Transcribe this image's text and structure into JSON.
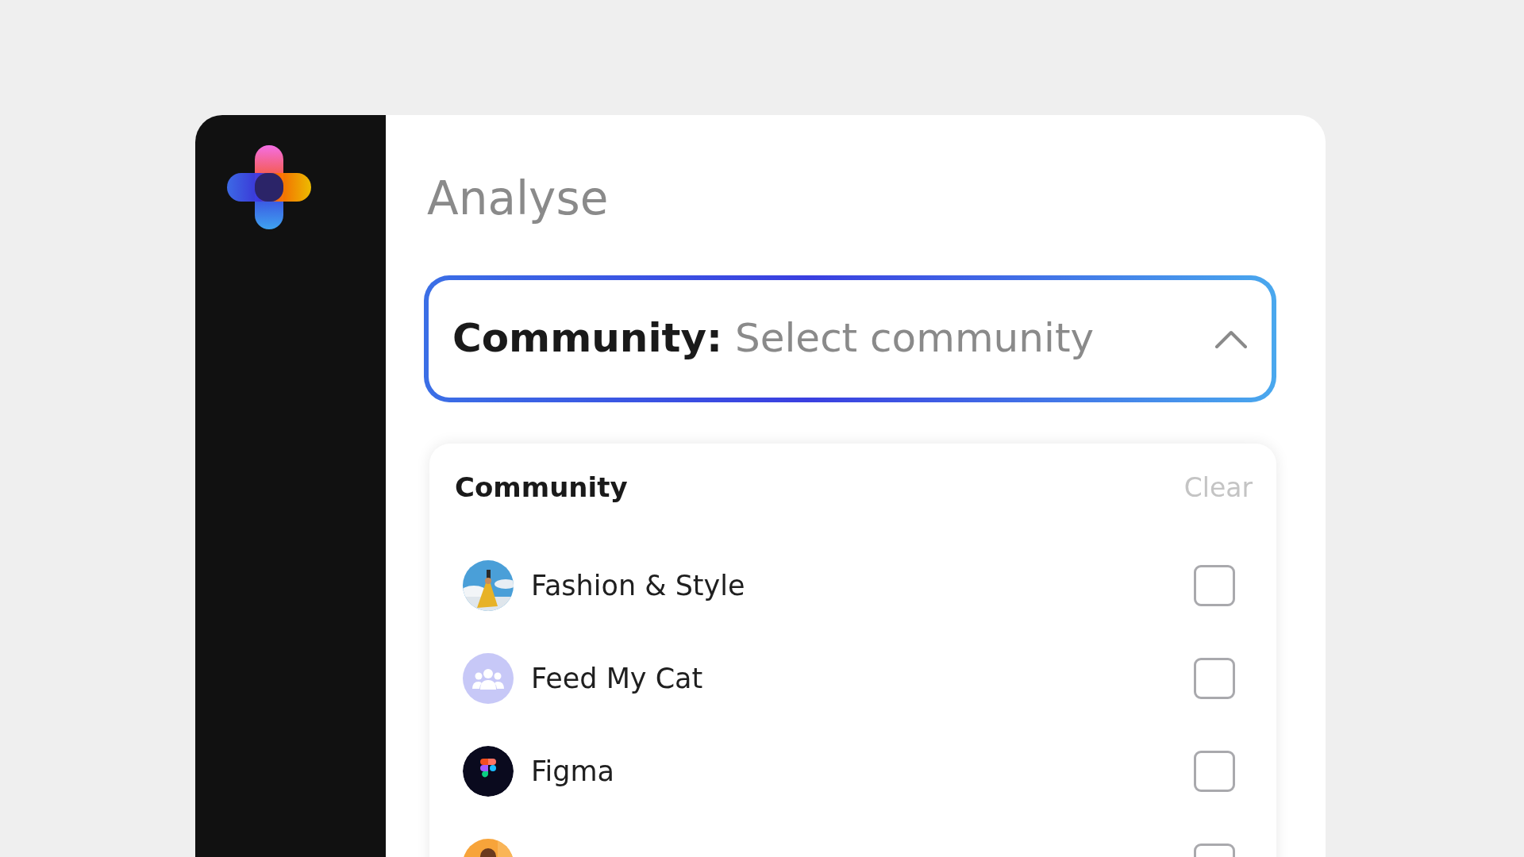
{
  "header": {
    "title": "Analyse"
  },
  "select": {
    "label": "Community:",
    "placeholder": "Select community",
    "expanded": true
  },
  "dropdown": {
    "heading": "Community",
    "clear": "Clear",
    "items": [
      {
        "kind": "picture",
        "label": "Fashion & Style",
        "checked": false
      },
      {
        "kind": "group",
        "label": "Feed My Cat",
        "checked": false
      },
      {
        "kind": "shapes",
        "label": "Figma",
        "checked": false
      },
      {
        "kind": "picture-warm",
        "checked": false
      }
    ]
  }
}
